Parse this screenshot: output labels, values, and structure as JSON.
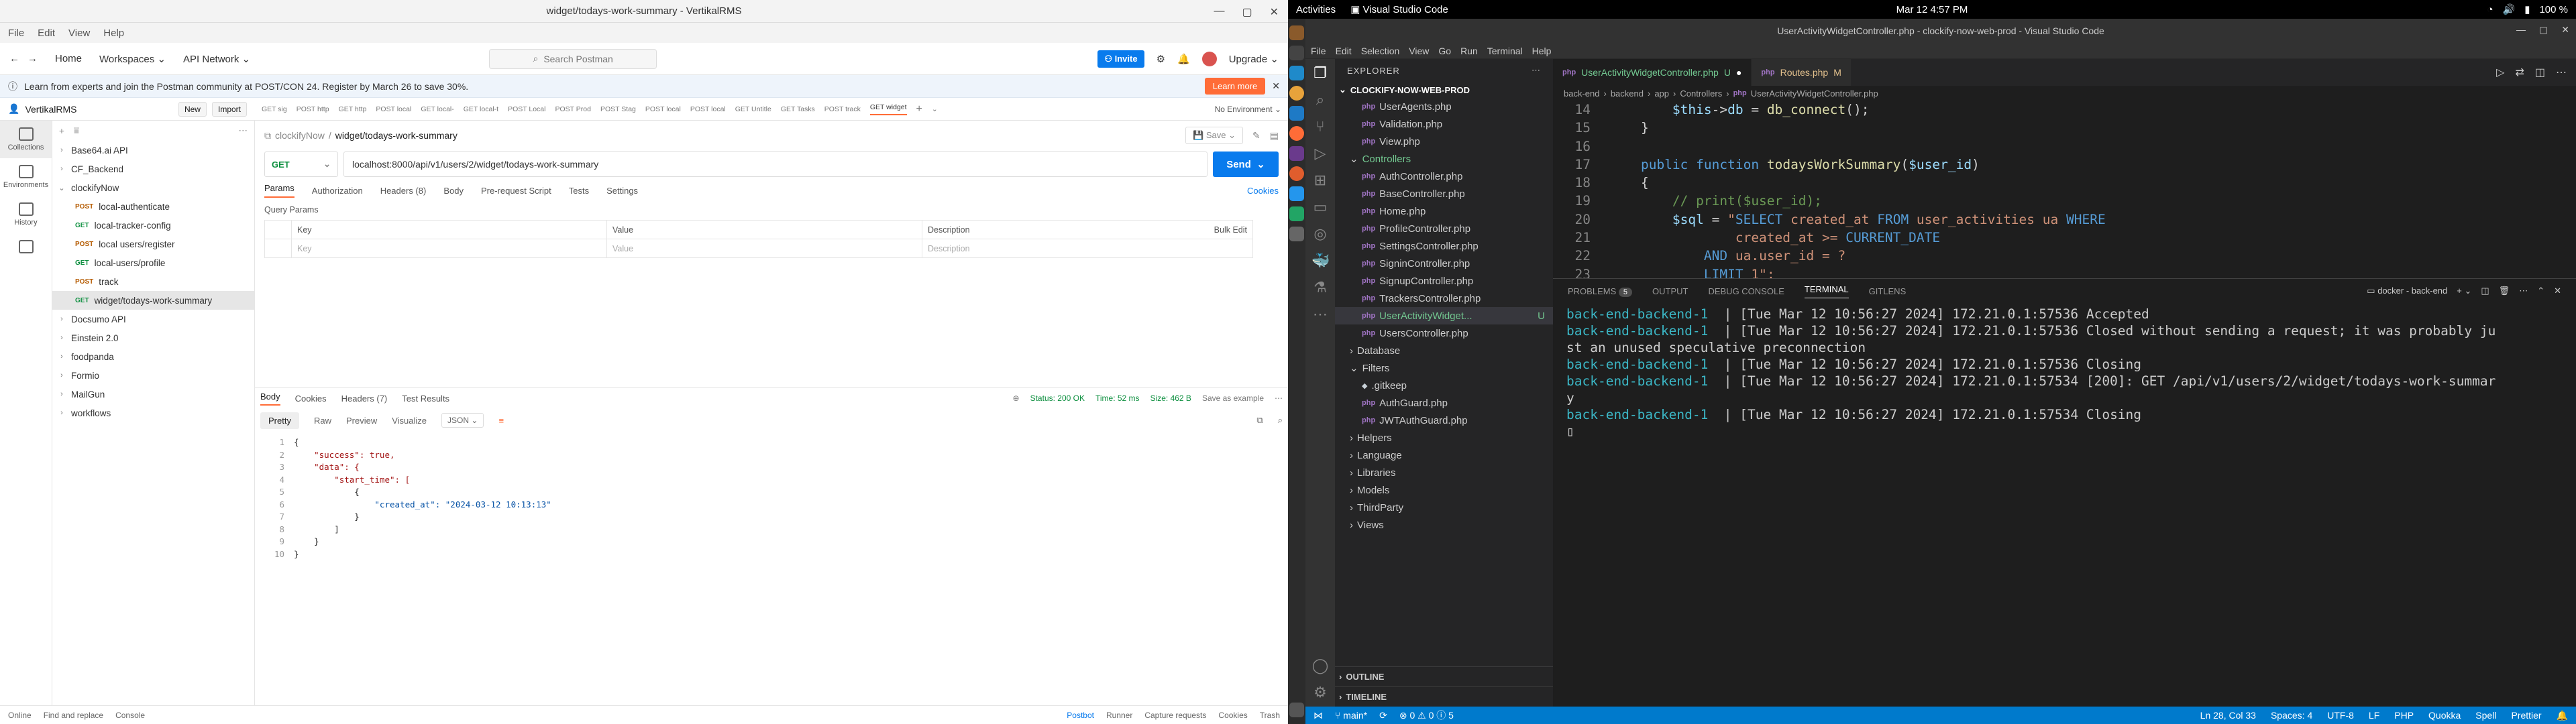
{
  "postman": {
    "title": "widget/todays-work-summary - VertikalRMS",
    "menu": [
      "File",
      "Edit",
      "View",
      "Help"
    ],
    "top": {
      "home": "Home",
      "workspaces": "Workspaces",
      "api_network": "API Network",
      "search": "Search Postman",
      "invite": "Invite",
      "upgrade": "Upgrade"
    },
    "banner": {
      "text": "Learn from experts and join the Postman community at POST/CON 24. Register by March 26 to save 30%.",
      "button": "Learn more"
    },
    "workspace": {
      "name": "VertikalRMS",
      "new": "New",
      "import": "Import"
    },
    "rail": [
      "Collections",
      "Environments",
      "History"
    ],
    "tree": [
      {
        "label": "Base64.ai API",
        "level": 0,
        "caret": "›"
      },
      {
        "label": "CF_Backend",
        "level": 0,
        "caret": "›"
      },
      {
        "label": "clockifyNow",
        "level": 0,
        "caret": "⌄"
      },
      {
        "label": "local-authenticate",
        "level": 1,
        "method": "POST"
      },
      {
        "label": "local-tracker-config",
        "level": 1,
        "method": "GET"
      },
      {
        "label": "local users/register",
        "level": 1,
        "method": "POST"
      },
      {
        "label": "local-users/profile",
        "level": 1,
        "method": "GET"
      },
      {
        "label": "track",
        "level": 1,
        "method": "POST"
      },
      {
        "label": "widget/todays-work-summary",
        "level": 1,
        "method": "GET",
        "selected": true
      },
      {
        "label": "Docsumo API",
        "level": 0,
        "caret": "›"
      },
      {
        "label": "Einstein 2.0",
        "level": 0,
        "caret": "›"
      },
      {
        "label": "foodpanda",
        "level": 0,
        "caret": "›"
      },
      {
        "label": "Formio",
        "level": 0,
        "caret": "›"
      },
      {
        "label": "MailGun",
        "level": 0,
        "caret": "›"
      },
      {
        "label": "workflows",
        "level": 0,
        "caret": "›"
      }
    ],
    "tabs": [
      "GET sig",
      "POST http",
      "GET http",
      "POST local",
      "GET local-",
      "GET local-t",
      "POST Local",
      "POST Prod",
      "POST Stag",
      "POST local",
      "POST local",
      "GET Untitle",
      "GET Tasks",
      "POST track",
      "GET widget"
    ],
    "env": "No Environment",
    "crumb": {
      "parent": "clockifyNow",
      "current": "widget/todays-work-summary",
      "save": "Save"
    },
    "request": {
      "method": "GET",
      "url": "localhost:8000/api/v1/users/2/widget/todays-work-summary",
      "send": "Send"
    },
    "req_tabs": [
      "Params",
      "Authorization",
      "Headers (8)",
      "Body",
      "Pre-request Script",
      "Tests",
      "Settings"
    ],
    "cookies": "Cookies",
    "query_label": "Query Params",
    "table": {
      "headers": [
        "Key",
        "Value",
        "Description",
        "Bulk Edit"
      ],
      "placeholders": [
        "Key",
        "Value",
        "Description"
      ]
    },
    "resp_tabs": [
      "Body",
      "Cookies",
      "Headers (7)",
      "Test Results"
    ],
    "resp_status": {
      "status": "Status: 200 OK",
      "time": "Time: 52 ms",
      "size": "Size: 462 B",
      "save": "Save as example"
    },
    "fmt_tabs": [
      "Pretty",
      "Raw",
      "Preview",
      "Visualize"
    ],
    "fmt": "JSON",
    "json_lines": [
      "{",
      "    \"success\": true,",
      "    \"data\": {",
      "        \"start_time\": [",
      "            {",
      "                \"created_at\": \"2024-03-12 10:13:13\"",
      "            }",
      "        ]",
      "    }",
      "}"
    ],
    "status_bar": [
      "Online",
      "Find and replace",
      "Console",
      "Postbot",
      "Runner",
      "Capture requests",
      "Cookies",
      "Trash"
    ]
  },
  "gnome": {
    "activities": "Activities",
    "app": "Visual Studio Code",
    "clock": "Mar 12  4:57 PM",
    "battery": "100 %"
  },
  "vscode": {
    "title": "UserActivityWidgetController.php - clockify-now-web-prod - Visual Studio Code",
    "menu": [
      "File",
      "Edit",
      "Selection",
      "View",
      "Go",
      "Run",
      "Terminal",
      "Help"
    ],
    "explorer_title": "EXPLORER",
    "project": "CLOCKIFY-NOW-WEB-PROD",
    "files": [
      {
        "name": "UserAgents.php",
        "indent": 2,
        "type": "php"
      },
      {
        "name": "Validation.php",
        "indent": 2,
        "type": "php"
      },
      {
        "name": "View.php",
        "indent": 2,
        "type": "php"
      },
      {
        "name": "Controllers",
        "indent": 1,
        "type": "folder-open"
      },
      {
        "name": "AuthController.php",
        "indent": 2,
        "type": "php"
      },
      {
        "name": "BaseController.php",
        "indent": 2,
        "type": "php"
      },
      {
        "name": "Home.php",
        "indent": 2,
        "type": "php"
      },
      {
        "name": "ProfileController.php",
        "indent": 2,
        "type": "php"
      },
      {
        "name": "SettingsController.php",
        "indent": 2,
        "type": "php"
      },
      {
        "name": "SigninController.php",
        "indent": 2,
        "type": "php"
      },
      {
        "name": "SignupController.php",
        "indent": 2,
        "type": "php"
      },
      {
        "name": "TrackersController.php",
        "indent": 2,
        "type": "php"
      },
      {
        "name": "UserActivityWidget...",
        "indent": 2,
        "type": "php",
        "selected": true,
        "status": "U"
      },
      {
        "name": "UsersController.php",
        "indent": 2,
        "type": "php"
      },
      {
        "name": "Database",
        "indent": 1,
        "type": "folder"
      },
      {
        "name": "Filters",
        "indent": 1,
        "type": "folder-open"
      },
      {
        "name": ".gitkeep",
        "indent": 2,
        "type": "git"
      },
      {
        "name": "AuthGuard.php",
        "indent": 2,
        "type": "php"
      },
      {
        "name": "JWTAuthGuard.php",
        "indent": 2,
        "type": "php"
      },
      {
        "name": "Helpers",
        "indent": 1,
        "type": "folder"
      },
      {
        "name": "Language",
        "indent": 1,
        "type": "folder"
      },
      {
        "name": "Libraries",
        "indent": 1,
        "type": "folder"
      },
      {
        "name": "Models",
        "indent": 1,
        "type": "folder"
      },
      {
        "name": "ThirdParty",
        "indent": 1,
        "type": "folder"
      },
      {
        "name": "Views",
        "indent": 1,
        "type": "folder"
      }
    ],
    "outline": "OUTLINE",
    "timeline": "TIMELINE",
    "tabs": [
      {
        "name": "UserActivityWidgetController.php",
        "mark": "U",
        "active": true
      },
      {
        "name": "Routes.php",
        "mark": "M",
        "active": false
      }
    ],
    "breadcrumb": [
      "back-end",
      "backend",
      "app",
      "Controllers",
      "UserActivityWidgetController.php"
    ],
    "code_start": 14,
    "current_line": 28,
    "panel_tabs": [
      "PROBLEMS",
      "OUTPUT",
      "DEBUG CONSOLE",
      "TERMINAL",
      "GITLENS"
    ],
    "problems_count": "5",
    "terminal_name": "docker - back-end",
    "terminal": [
      {
        "prefix": "back-end-backend-1",
        "text": "  | [Tue Mar 12 10:56:27 2024] 172.21.0.1:57536 Accepted"
      },
      {
        "prefix": "back-end-backend-1",
        "text": "  | [Tue Mar 12 10:56:27 2024] 172.21.0.1:57536 Closed without sending a request; it was probably ju"
      },
      {
        "prefix": "",
        "text": "st an unused speculative preconnection"
      },
      {
        "prefix": "back-end-backend-1",
        "text": "  | [Tue Mar 12 10:56:27 2024] 172.21.0.1:57536 Closing"
      },
      {
        "prefix": "back-end-backend-1",
        "text": "  | [Tue Mar 12 10:56:27 2024] 172.21.0.1:57534 [200]: GET /api/v1/users/2/widget/todays-work-summar"
      },
      {
        "prefix": "",
        "text": "y"
      },
      {
        "prefix": "back-end-backend-1",
        "text": "  | [Tue Mar 12 10:56:27 2024] 172.21.0.1:57534 Closing"
      }
    ],
    "status": {
      "branch": "main*",
      "errors": "⊗ 0 ⚠ 0 ⓘ 5",
      "position": "Ln 28, Col 33",
      "spaces": "Spaces: 4",
      "encoding": "UTF-8",
      "eol": "LF",
      "lang": "PHP",
      "ext1": "Quokka",
      "ext2": "Spell",
      "ext3": "Prettier"
    }
  },
  "colors": {
    "accent_orange": "#ff6c37",
    "postman_blue": "#097bed",
    "vscode_status": "#007acc"
  }
}
